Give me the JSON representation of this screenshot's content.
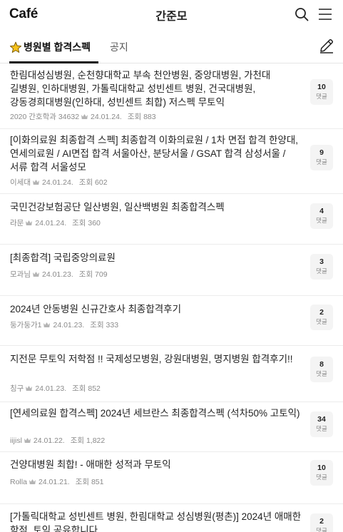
{
  "header": {
    "logo": "Café",
    "title": "간준모",
    "icons": {
      "search": "search-icon",
      "menu": "menu-icon"
    }
  },
  "tabs": {
    "active": {
      "label": "병원별 합격스펙",
      "icon": "star-icon"
    },
    "notice": {
      "label": "공지"
    },
    "write_icon": "pencil-icon"
  },
  "comment_label": "댓글",
  "posts": [
    {
      "title": "한림대성심병원, 순천향대학교 부속 천안병원, 중앙대병원, 가천대 길병원, 인하대병원, 가톨릭대학교 성빈센트 병원, 건국대병원, 강동경희대병원(인하대, 성빈센트 최합) 저스펙 무토익",
      "author": "2020 간호학과 34632",
      "date": "24.01.24.",
      "views": "조회 883",
      "comments": "10"
    },
    {
      "title": "[이화의료원 최종합격 스펙] 최종합격 이화의료원 / 1차 면접 합격 한양대, 연세의료원 / AI면접 합격 서울아산, 분당서울 / GSAT 합격 삼성서울 / 서류 합격 서울성모",
      "author": "이세대",
      "date": "24.01.24.",
      "views": "조회 602",
      "comments": "9"
    },
    {
      "title": "국민건강보험공단 일산병원, 일산백병원 최종합격스펙",
      "author": "라문",
      "date": "24.01.24.",
      "views": "조회 360",
      "comments": "4"
    },
    {
      "title": "[최종합격] 국립중앙의료원",
      "author": "모과님",
      "date": "24.01.23.",
      "views": "조회 709",
      "comments": "3"
    },
    {
      "title": "2024년 안동병원 신규간호사 최종합격후기",
      "author": "둥가둥가1",
      "date": "24.01.23.",
      "views": "조회 333",
      "comments": "2"
    },
    {
      "title": "지전문 무토익 저학점 !! 국제성모병원, 강원대병원, 명지병원 합격후기!!",
      "author": "칭구",
      "date": "24.01.23.",
      "views": "조회 852",
      "comments": "8"
    },
    {
      "title": "[연세의료원 합격스펙] 2024년 세브란스 최종합격스펙 (석차50% 고토익)",
      "author": "iijisl",
      "date": "24.01.22.",
      "views": "조회 1,822",
      "comments": "34"
    },
    {
      "title": "건양대병원 최합! - 애매한 성적과 무토익",
      "author": "Rolla",
      "date": "24.01.21.",
      "views": "조회 851",
      "comments": "10"
    },
    {
      "title": "[가톨릭대학교 성빈센트 병원, 한림대학교 성심병원(평촌)] 2024년 애매한 학점, 토익 공유합니다",
      "author": "",
      "date": "",
      "views": "",
      "comments": "2"
    }
  ]
}
